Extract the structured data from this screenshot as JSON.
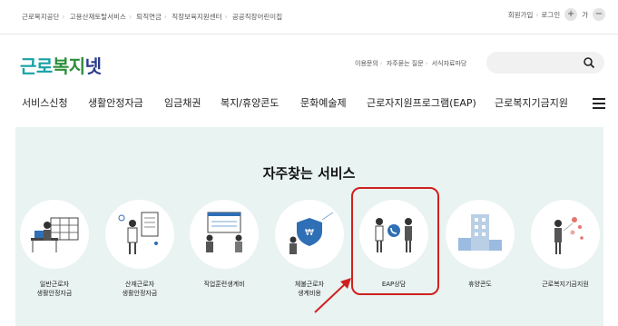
{
  "utility_bar": {
    "sites": [
      "근로복지공단",
      "고용산재토탈서비스",
      "퇴직연금",
      "직장보육지원센터",
      "공공직장어린이집"
    ],
    "join": "회원가입",
    "login": "로그인",
    "zoom_in": "+",
    "font_label": "가",
    "zoom_out": "−"
  },
  "header": {
    "logo_part1": "근로",
    "logo_part2": "복지",
    "logo_part3": "넷",
    "quick_links": [
      "이용문의",
      "자주묻는 질문",
      "서식자료마당"
    ],
    "search_placeholder": ""
  },
  "nav": {
    "items": [
      "서비스신청",
      "생활안정자금",
      "임금채권",
      "복지/휴양콘도",
      "문화예술제",
      "근로자지원프로그램(EAP)",
      "근로복지기금지원"
    ]
  },
  "main": {
    "title": "자주찾는 서비스",
    "services": [
      {
        "label_line1": "일반근로자",
        "label_line2": "생활안정자금"
      },
      {
        "label_line1": "산재근로자",
        "label_line2": "생활안정자금"
      },
      {
        "label_line1": "직업훈련생계비",
        "label_line2": ""
      },
      {
        "label_line1": "체불근로자",
        "label_line2": "생계비용"
      },
      {
        "label_line1": "EAP상담",
        "label_line2": ""
      },
      {
        "label_line1": "휴양콘도",
        "label_line2": ""
      },
      {
        "label_line1": "근로복지기금지원",
        "label_line2": ""
      }
    ]
  },
  "colors": {
    "logo_teal": "#17a2a6",
    "logo_green": "#2d8f3c",
    "logo_navy": "#2a3a8c",
    "band_bg": "#e9f3f2",
    "highlight_red": "#d0201e"
  }
}
